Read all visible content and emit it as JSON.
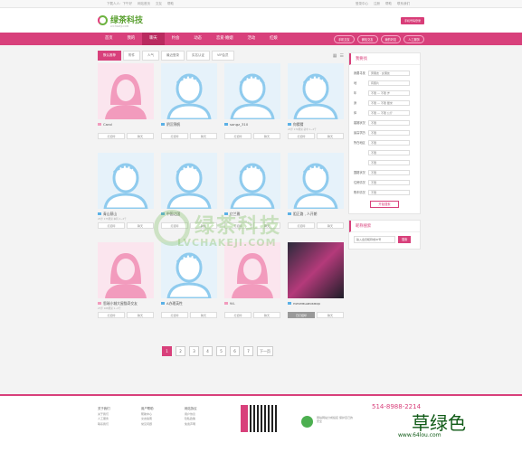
{
  "topbar": {
    "left": [
      "下载人人：下午好",
      "网站首页",
      "交友",
      "帮助"
    ],
    "right": [
      "登录中心",
      "注册",
      "帮助",
      "联系我们"
    ]
  },
  "logo": {
    "name": "绿茶科技",
    "tagline": "LVCHAKEJI.COM",
    "app_button": "手机号码登录"
  },
  "nav": {
    "items": [
      "首页",
      "我的",
      "聊天",
      "约会",
      "动态",
      "恋爱·婚姻",
      "活动",
      "红娘"
    ],
    "active": 2,
    "pills": [
      "手机交友",
      "微信交友",
      "我的好友",
      "人工服务"
    ]
  },
  "tabs": {
    "items": [
      "默认推荐",
      "附件",
      "人气",
      "最近登录",
      "实名认证",
      "VIP会员"
    ],
    "active": 0
  },
  "cards": [
    {
      "name": "Carol",
      "meta": "",
      "gender": "f",
      "buttons": [
        "打招呼",
        "聊天"
      ]
    },
    {
      "name": "阴沉锦帆",
      "meta": "",
      "gender": "m",
      "buttons": [
        "打招呼",
        "聊天"
      ]
    },
    {
      "name": "songz_310",
      "meta": "",
      "gender": "m",
      "buttons": [
        "打招呼",
        "聊天"
      ]
    },
    {
      "name": "你猜猜",
      "meta": "23岁 170厘米 初中 1~2千",
      "gender": "m",
      "buttons": [
        "打招呼",
        "聊天"
      ]
    },
    {
      "name": "青山蔡山",
      "meta": "25岁 175厘米 本科 1~2千",
      "gender": "m",
      "buttons": [
        "打招呼",
        "聊天"
      ]
    },
    {
      "name": "中国之国",
      "meta": "",
      "gender": "m",
      "buttons": [
        "打招呼",
        "聊天"
      ]
    },
    {
      "name": "亿兰雅",
      "meta": "",
      "gender": "m",
      "buttons": [
        "打招呼",
        "聊天"
      ]
    },
    {
      "name": "阻正路 , 人开朗",
      "meta": "",
      "gender": "m",
      "buttons": [
        "打招呼",
        "聊天"
      ]
    },
    {
      "name": "思瑞小城大屋猫奇交友",
      "meta": "27岁 168厘米 1~2千",
      "gender": "f",
      "buttons": [
        "打招呼",
        "聊天"
      ]
    },
    {
      "name": "A办理英性",
      "meta": "",
      "gender": "m",
      "buttons": [
        "打招呼",
        "聊天"
      ]
    },
    {
      "name": "94.",
      "meta": "",
      "gender": "f",
      "buttons": [
        "打招呼",
        "聊天"
      ]
    },
    {
      "name": "ничемшиоквор",
      "meta": "",
      "gender": "photo",
      "buttons": [
        "已打招呼",
        "聊天"
      ]
    }
  ],
  "pager": [
    "1",
    "2",
    "3",
    "4",
    "5",
    "6",
    "7",
    "下一页"
  ],
  "pager_active": 0,
  "side_search": {
    "title": "我要找",
    "rows": [
      {
        "label": "我要寻找",
        "value": "男朋友 · 女朋友"
      },
      {
        "label": "地",
        "value": "有照片"
      },
      {
        "label": "年",
        "value": "不限 — 不限 岁"
      },
      {
        "label": "身",
        "value": "不限 — 不限 厘米"
      },
      {
        "label": "体",
        "value": "不限 — 不限 公斤"
      },
      {
        "label": "婚姻状况",
        "value": "不限"
      },
      {
        "label": "最高学历",
        "value": "不限"
      },
      {
        "label": "所在地区",
        "value": "不限"
      },
      {
        "label": "",
        "value": "不限"
      },
      {
        "label": "",
        "value": "不限"
      },
      {
        "label": "国籍状况",
        "value": "不限"
      },
      {
        "label": "住房情况",
        "value": "不限"
      },
      {
        "label": "购车情况",
        "value": "不限"
      }
    ],
    "button": "开始搜索"
  },
  "side_nick": {
    "title": "昵称搜索",
    "placeholder": "输入会员昵称或ID号",
    "button": "搜索"
  },
  "footer": {
    "cols": [
      {
        "title": "关于我们",
        "items": [
          "关于我们",
          "人工服务",
          "联系我们"
        ]
      },
      {
        "title": "用户帮助",
        "items": [
          "帮助中心",
          "交友指南",
          "常见问题"
        ]
      },
      {
        "title": "网站协议",
        "items": [
          "用户协议",
          "隐私政策",
          "免责声明"
        ]
      }
    ],
    "phone": "514-8988-2214",
    "service_note": "网站网站分成绩接 保护自己的安全",
    "watermark": "绿茶科技",
    "watermark_url": "LVCHAKEJI.COM",
    "corner_text": "草绿色",
    "corner_url": "www.64lou.com"
  }
}
